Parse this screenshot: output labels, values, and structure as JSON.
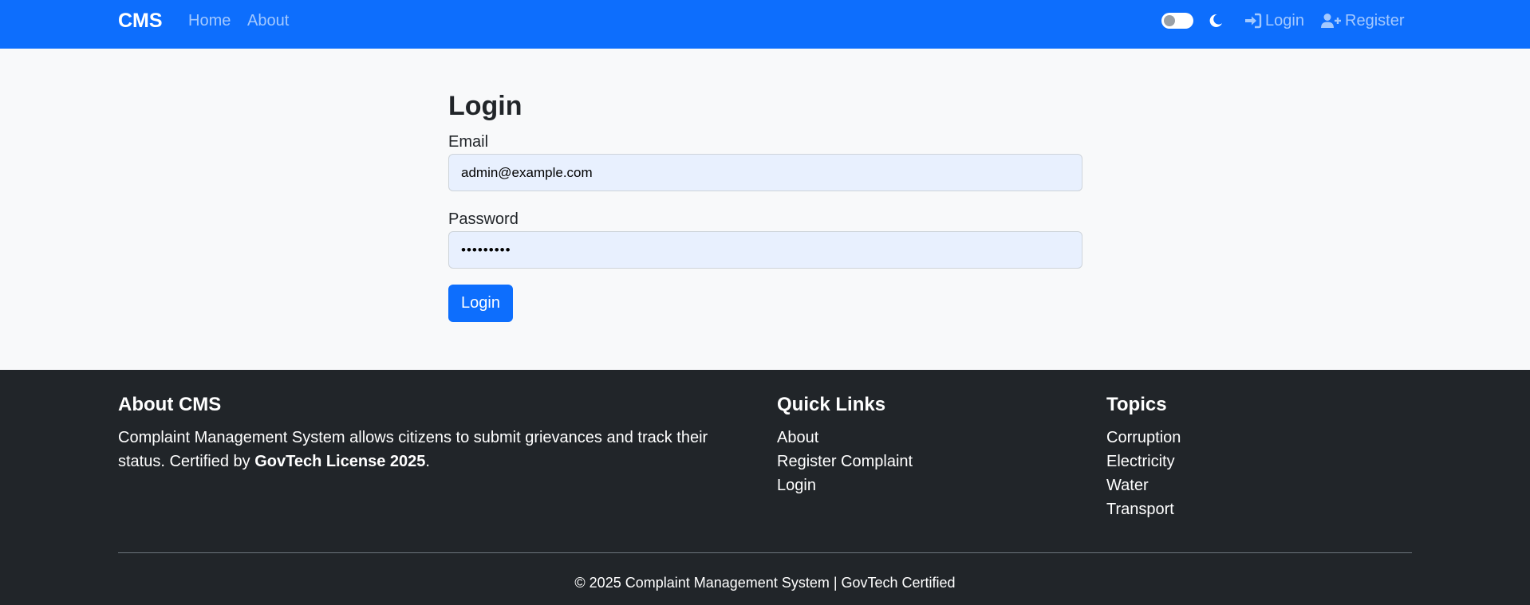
{
  "navbar": {
    "brand": "CMS",
    "links": [
      {
        "label": "Home"
      },
      {
        "label": "About"
      }
    ],
    "login_label": "Login",
    "register_label": "Register",
    "theme_toggle_on": false,
    "icons": [
      "moon-icon",
      "sign-in-icon",
      "user-plus-icon"
    ]
  },
  "login_form": {
    "title": "Login",
    "email_label": "Email",
    "email_value": "admin@example.com",
    "password_label": "Password",
    "password_value": "•••••••••",
    "submit_label": "Login"
  },
  "footer": {
    "about": {
      "heading": "About CMS",
      "text_prefix": "Complaint Management System allows citizens to submit grievances and track their status. Certified by ",
      "text_bold": "GovTech License 2025",
      "text_suffix": "."
    },
    "quick_links": {
      "heading": "Quick Links",
      "items": [
        {
          "label": "About"
        },
        {
          "label": "Register Complaint"
        },
        {
          "label": "Login"
        }
      ]
    },
    "topics": {
      "heading": "Topics",
      "items": [
        {
          "label": "Corruption"
        },
        {
          "label": "Electricity"
        },
        {
          "label": "Water"
        },
        {
          "label": "Transport"
        }
      ]
    },
    "copyright": "© 2025 Complaint Management System | GovTech Certified"
  },
  "colors": {
    "primary": "#0d6efd",
    "footer_bg": "#212529",
    "page_bg": "#f8f9fa",
    "input_bg": "#e8f0fe"
  }
}
